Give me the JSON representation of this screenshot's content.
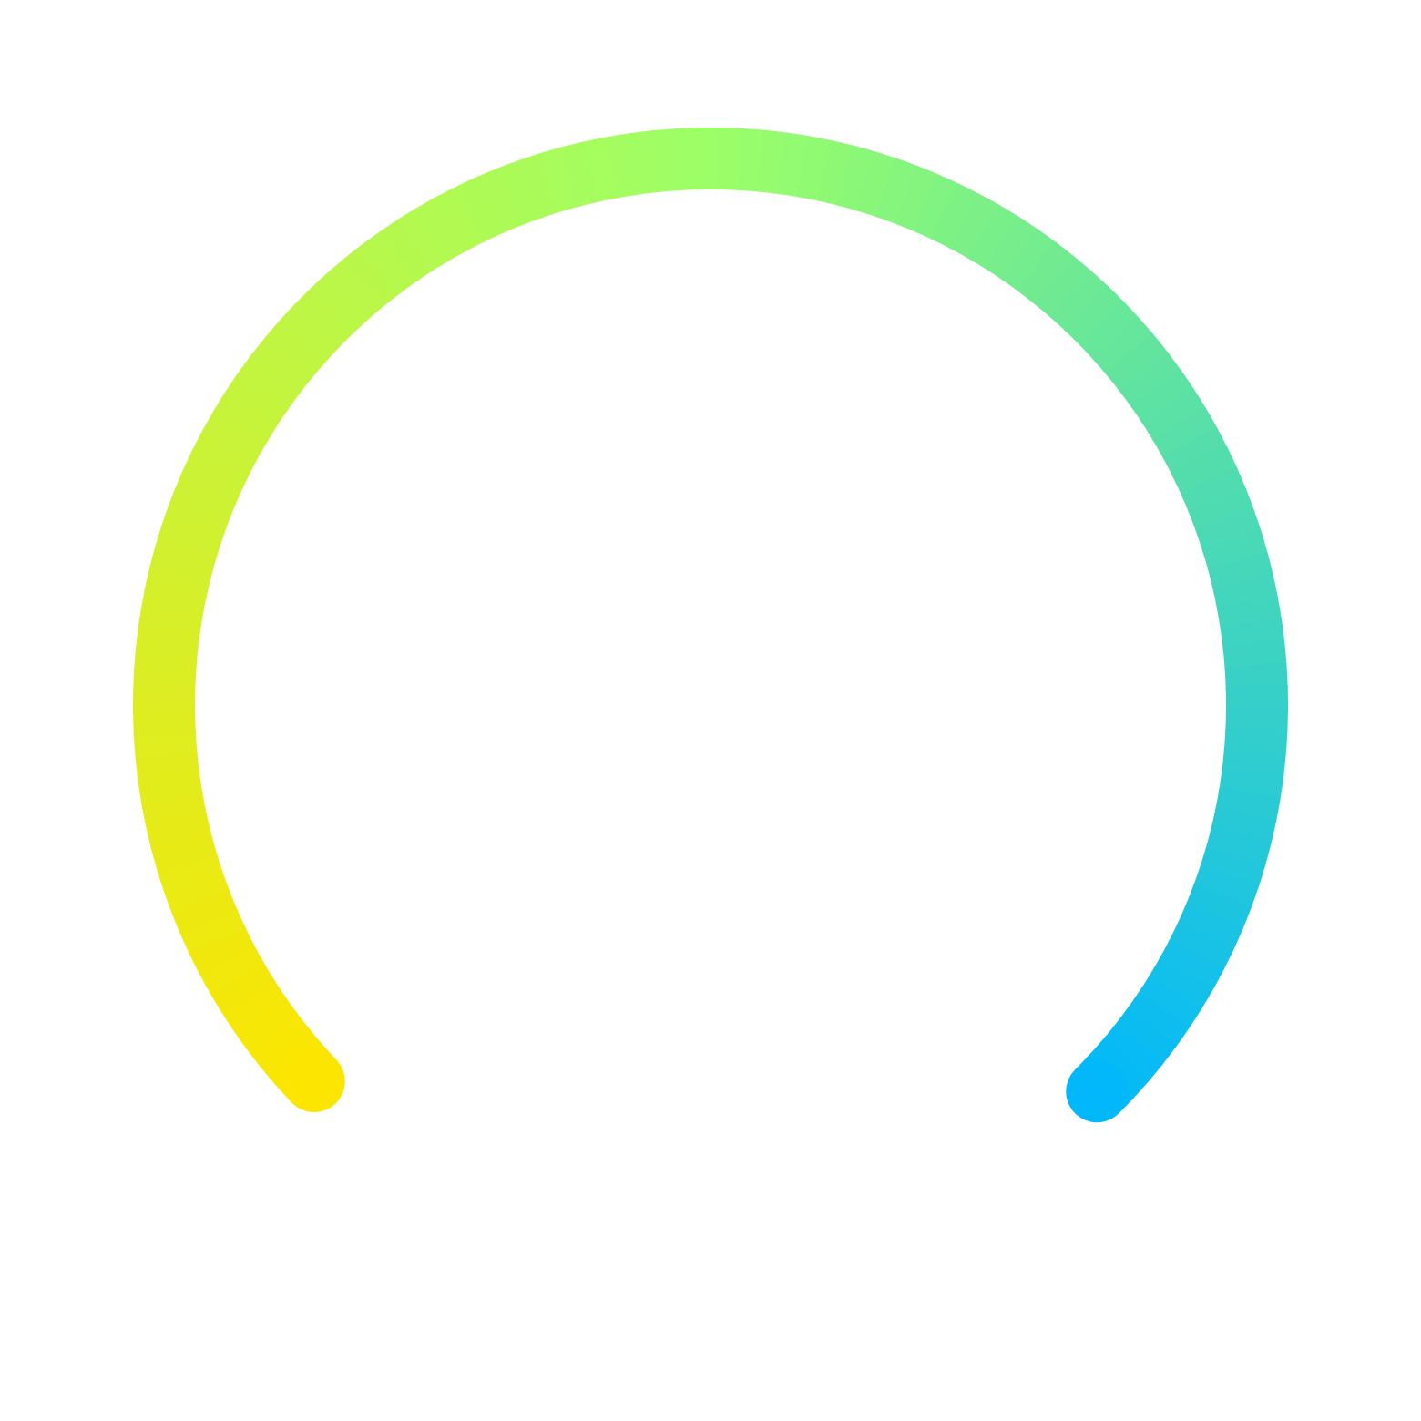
{
  "gauge": {
    "icon": "gradient-arc-gauge-icon",
    "colors": {
      "start": "#FCE500",
      "middle": "#9CFF68",
      "end": "#02B8FA"
    }
  }
}
